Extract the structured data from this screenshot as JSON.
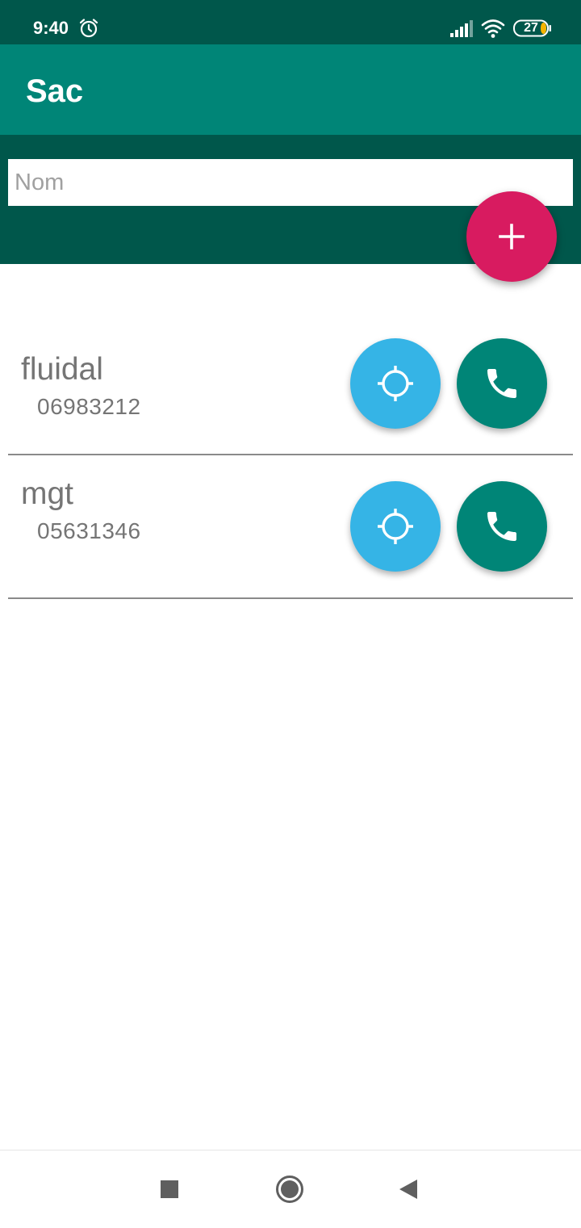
{
  "status_bar": {
    "time": "9:40",
    "battery_level": "27",
    "icons": [
      "alarm-icon",
      "signal-icon",
      "wifi-icon",
      "battery-icon"
    ]
  },
  "app_bar": {
    "title": "Sac"
  },
  "search": {
    "placeholder": "Nom",
    "value": ""
  },
  "add_button": {
    "icon": "plus-icon"
  },
  "contacts": [
    {
      "name": "fluidal",
      "phone": "06983212",
      "locate_icon": "crosshair-icon",
      "call_icon": "phone-icon"
    },
    {
      "name": "mgt",
      "phone": "05631346",
      "locate_icon": "crosshair-icon",
      "call_icon": "phone-icon"
    }
  ],
  "nav_bar": {
    "icons": [
      "recents-square-icon",
      "home-circle-icon",
      "back-triangle-icon"
    ]
  },
  "colors": {
    "status_bar": "#00574b",
    "app_bar": "#008577",
    "accent": "#d81b60",
    "locate_button": "#35b4e6",
    "call_button": "#008577",
    "text_secondary": "#757575"
  }
}
